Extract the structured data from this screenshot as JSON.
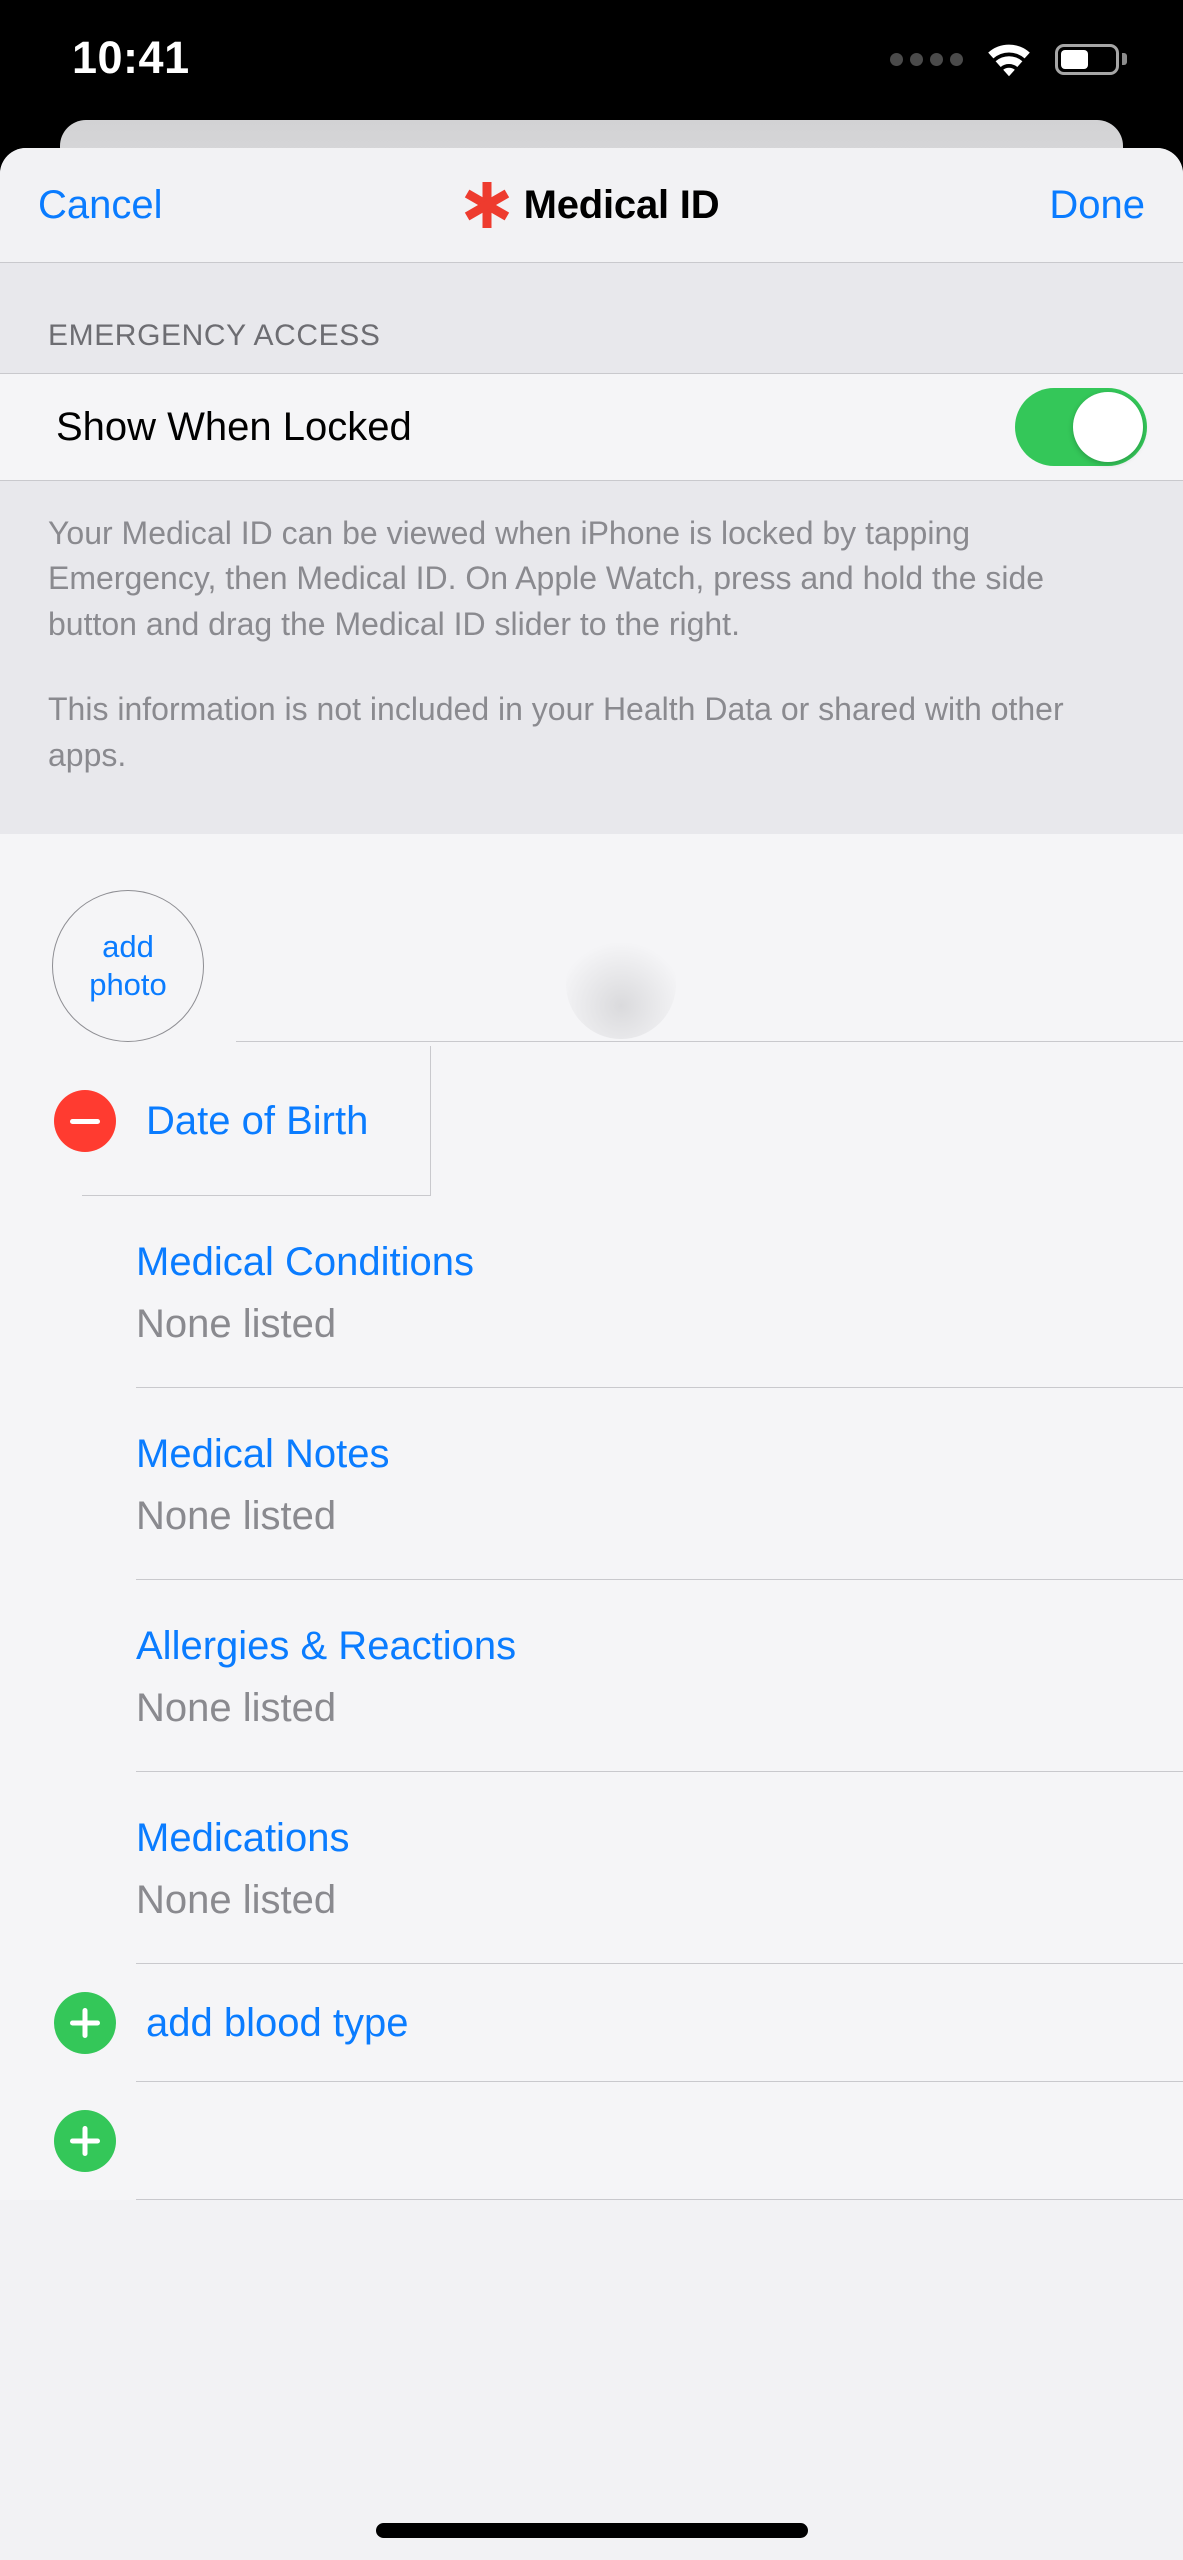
{
  "status_bar": {
    "time": "10:41",
    "signal_icon": "signal-dots-icon",
    "wifi_icon": "wifi-icon",
    "battery_icon": "battery-icon",
    "battery_level_percent": 52
  },
  "navbar": {
    "cancel_label": "Cancel",
    "title": "Medical ID",
    "title_icon": "medical-star-icon",
    "done_label": "Done"
  },
  "emergency_section": {
    "header": "EMERGENCY ACCESS",
    "toggle_label": "Show When Locked",
    "toggle_state": "on",
    "toggle_on_color": "#34c759",
    "description_paragraphs": [
      "Your Medical ID can be viewed when iPhone is locked by tapping Emergency, then Medical ID. On Apple Watch, press and hold the side button and drag the Medical ID slider to the right.",
      "This information is not included in your Health Data or shared with other apps."
    ]
  },
  "profile": {
    "add_photo_line1": "add",
    "add_photo_line2": "photo",
    "name_value": "",
    "date_of_birth": {
      "label": "Date of Birth",
      "value": "",
      "remove_icon": "minus-circle-icon",
      "remove_color": "#ff3b30"
    }
  },
  "fields": [
    {
      "label": "Medical Conditions",
      "value": "None listed"
    },
    {
      "label": "Medical Notes",
      "value": "None listed"
    },
    {
      "label": "Allergies & Reactions",
      "value": "None listed"
    },
    {
      "label": "Medications",
      "value": "None listed"
    }
  ],
  "add_rows": [
    {
      "label": "add blood type",
      "icon": "plus-circle-icon"
    },
    {
      "label": "",
      "icon": "plus-circle-icon"
    }
  ],
  "colors": {
    "accent_blue": "#0a7cff",
    "green": "#34c759",
    "red": "#ff3b30",
    "placeholder_gray": "#8a8a8f"
  }
}
